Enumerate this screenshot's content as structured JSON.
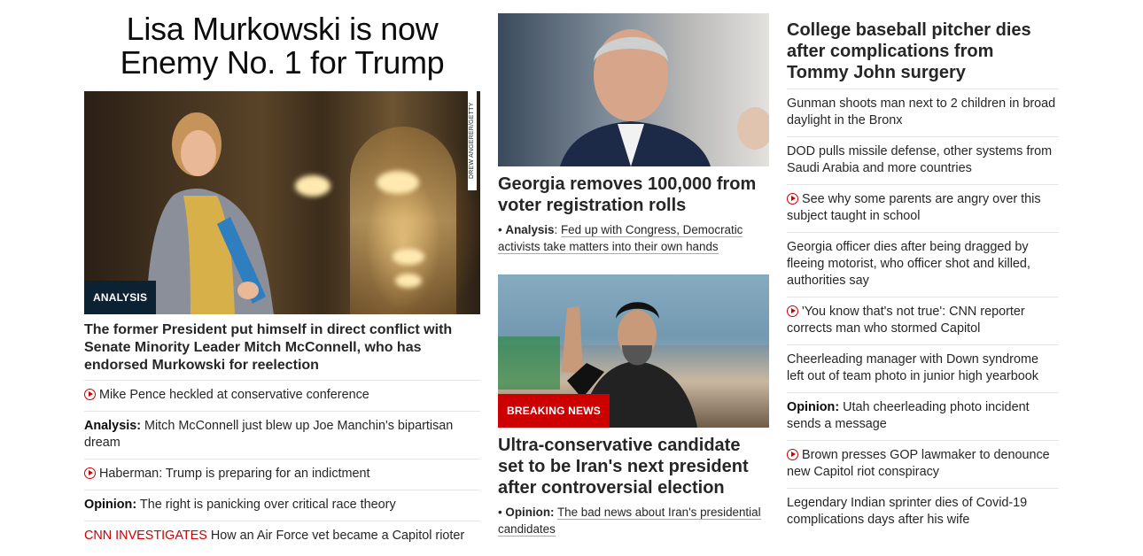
{
  "hero": {
    "title": "Lisa Murkowski is now Enemy No. 1 for Trump",
    "image_credit": "DREW ANGERER/GETTY IMAGES",
    "tag": "ANALYSIS",
    "lead": "The former President put himself in direct conflict with Senate Minority Leader Mitch McConnell, who has endorsed Murkowski for reelection",
    "items": [
      {
        "video": true,
        "kicker": "",
        "text": "Mike Pence heckled at conservative conference"
      },
      {
        "video": false,
        "kicker": "Analysis:",
        "text": "Mitch McConnell just blew up Joe Manchin's bipartisan dream"
      },
      {
        "video": true,
        "kicker": "",
        "text": "Haberman: Trump is preparing for an indictment"
      },
      {
        "video": false,
        "kicker": "Opinion:",
        "text": "The right is panicking over critical race theory"
      },
      {
        "video": false,
        "kicker_red": "CNN INVESTIGATES",
        "text": "How an Air Force vet became a Capitol rioter"
      }
    ]
  },
  "middle": {
    "story1": {
      "title": "Georgia removes 100,000 from voter registration rolls",
      "bullet_kicker": "Analysis",
      "bullet_text": "Fed up with Congress, Democratic activists take matters into their own hands"
    },
    "story2": {
      "tag": "BREAKING NEWS",
      "title": "Ultra-conservative candidate set to be Iran's next president after controversial election",
      "bullet_kicker": "Opinion:",
      "bullet_text": "The bad news about Iran's presidential candidates"
    }
  },
  "right": {
    "title": "College baseball pitcher dies after complications from Tommy John surgery",
    "items": [
      {
        "video": false,
        "kicker": "",
        "text": "Gunman shoots man next to 2 children in broad daylight in the Bronx"
      },
      {
        "video": false,
        "kicker": "",
        "text": "DOD pulls missile defense, other systems from Saudi Arabia and more countries"
      },
      {
        "video": true,
        "kicker": "",
        "text": "See why some parents are angry over this subject taught in school"
      },
      {
        "video": false,
        "kicker": "",
        "text": "Georgia officer dies after being dragged by fleeing motorist, who officer shot and killed, authorities say"
      },
      {
        "video": true,
        "kicker": "",
        "text": "'You know that's not true': CNN reporter corrects man who stormed Capitol"
      },
      {
        "video": false,
        "kicker": "",
        "text": "Cheerleading manager with Down syndrome left out of team photo in junior high yearbook"
      },
      {
        "video": false,
        "kicker": "Opinion:",
        "text": "Utah cheerleading photo incident sends a message"
      },
      {
        "video": true,
        "kicker": "",
        "text": "Brown presses GOP lawmaker to denounce new Capitol riot conspiracy"
      },
      {
        "video": false,
        "kicker": "",
        "text": "Legendary Indian sprinter dies of Covid-19 complications days after his wife"
      }
    ]
  },
  "colors": {
    "accent": "#cc0000",
    "analysis_tag": "#0c2132",
    "text": "#262626"
  },
  "icons": {
    "video": "play-circle-icon"
  }
}
